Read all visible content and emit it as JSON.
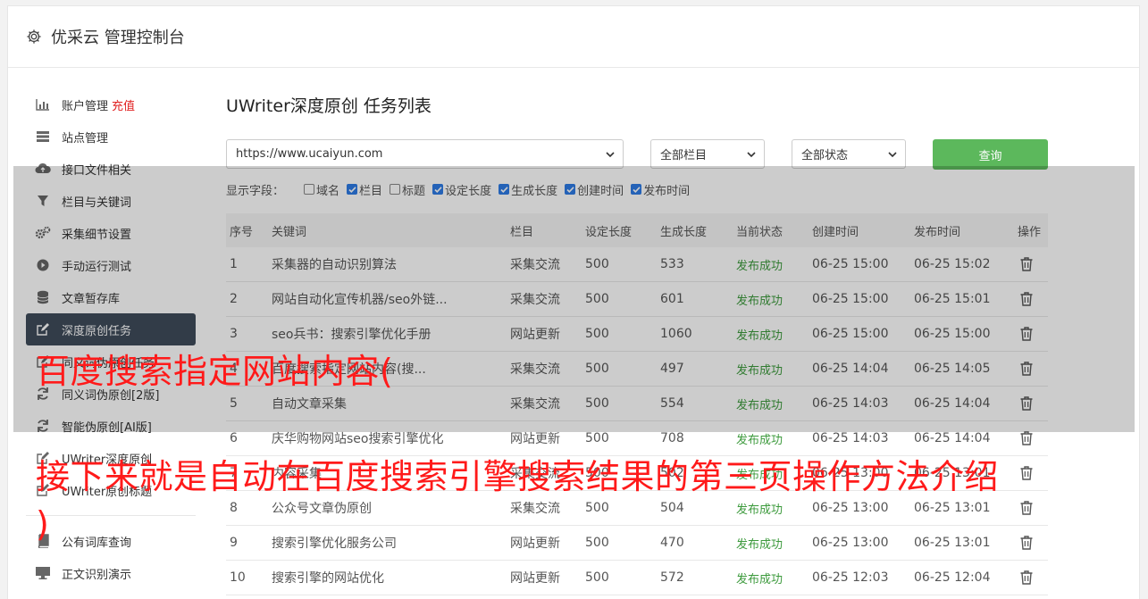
{
  "header": {
    "title": "优采云 管理控制台"
  },
  "sidebar": {
    "items": [
      {
        "label": "账户管理",
        "extra": "充值",
        "icon": "bar-chart-icon"
      },
      {
        "label": "站点管理",
        "icon": "server-icon"
      },
      {
        "label": "接口文件相关",
        "icon": "cloud-upload-icon"
      },
      {
        "label": "栏目与关键词",
        "icon": "filter-icon"
      },
      {
        "label": "采集细节设置",
        "icon": "cogs-icon"
      },
      {
        "label": "手动运行测试",
        "icon": "play-icon"
      },
      {
        "label": "文章暂存库",
        "icon": "database-icon"
      },
      {
        "label": "深度原创任务",
        "icon": "edit-icon"
      },
      {
        "label": "同义词伪原创任务",
        "icon": "edit-icon"
      },
      {
        "label": "同义词伪原创[2版]",
        "icon": "refresh-icon"
      },
      {
        "label": "智能伪原创[AI版]",
        "icon": "refresh-icon"
      },
      {
        "label": "UWriter深度原创",
        "icon": "edit-icon"
      },
      {
        "label": "UWriter原创标题",
        "icon": "edit-icon"
      },
      {
        "label": "公有词库查询",
        "icon": "book-icon"
      },
      {
        "label": "正文识别演示",
        "icon": "monitor-icon"
      }
    ]
  },
  "main": {
    "title": "UWriter深度原创 任务列表",
    "site_select": "https://www.ucaiyun.com",
    "column_select": "全部栏目",
    "status_select": "全部状态",
    "query_button": "查询",
    "fields_label": "显示字段：",
    "fields": [
      {
        "label": "域名",
        "checked": false
      },
      {
        "label": "栏目",
        "checked": true
      },
      {
        "label": "标题",
        "checked": false
      },
      {
        "label": "设定长度",
        "checked": true
      },
      {
        "label": "生成长度",
        "checked": true
      },
      {
        "label": "创建时间",
        "checked": true
      },
      {
        "label": "发布时间",
        "checked": true
      }
    ],
    "columns": [
      "序号",
      "关键词",
      "栏目",
      "设定长度",
      "生成长度",
      "当前状态",
      "创建时间",
      "发布时间",
      "操作"
    ],
    "rows": [
      [
        "1",
        "采集器的自动识别算法",
        "采集交流",
        "500",
        "533",
        "发布成功",
        "06-25 15:00",
        "06-25 15:02"
      ],
      [
        "2",
        "网站自动化宣传机器/seo外链...",
        "采集交流",
        "500",
        "601",
        "发布成功",
        "06-25 15:00",
        "06-25 15:01"
      ],
      [
        "3",
        "seo兵书：搜索引擎优化手册",
        "网站更新",
        "500",
        "1060",
        "发布成功",
        "06-25 15:00",
        "06-25 15:00"
      ],
      [
        "4",
        "百度搜索指定网站内容(搜...",
        "采集交流",
        "500",
        "497",
        "发布成功",
        "06-25 14:04",
        "06-25 14:05"
      ],
      [
        "5",
        "自动文章采集",
        "采集交流",
        "500",
        "554",
        "发布成功",
        "06-25 14:03",
        "06-25 14:04"
      ],
      [
        "6",
        "庆华购物网站seo搜索引擎优化",
        "网站更新",
        "500",
        "708",
        "发布成功",
        "06-25 14:03",
        "06-25 14:04"
      ],
      [
        "7",
        "内容采集",
        "采集交流",
        "500",
        "502",
        "发布成功",
        "06-25 13:00",
        "06-25 13:01"
      ],
      [
        "8",
        "公众号文章伪原创",
        "采集交流",
        "500",
        "504",
        "发布成功",
        "06-25 13:00",
        "06-25 13:01"
      ],
      [
        "9",
        "搜索引擎优化服务公司",
        "网站更新",
        "500",
        "470",
        "发布成功",
        "06-25 13:00",
        "06-25 13:01"
      ],
      [
        "10",
        "搜索引擎的网站优化",
        "网站更新",
        "500",
        "572",
        "发布成功",
        "06-25 12:03",
        "06-25 12:04"
      ]
    ]
  },
  "captions": {
    "line1": "百度搜索指定网站内容(",
    "line2": "接下来就是自动在百度搜索引擎搜索结果的第三页操作方法介绍",
    "line3": ")"
  },
  "colors": {
    "accent_green": "#5cb85c",
    "active_nav": "#3f4b5b",
    "recharge_red": "#e02020",
    "caption_red": "#ff1a1a"
  }
}
